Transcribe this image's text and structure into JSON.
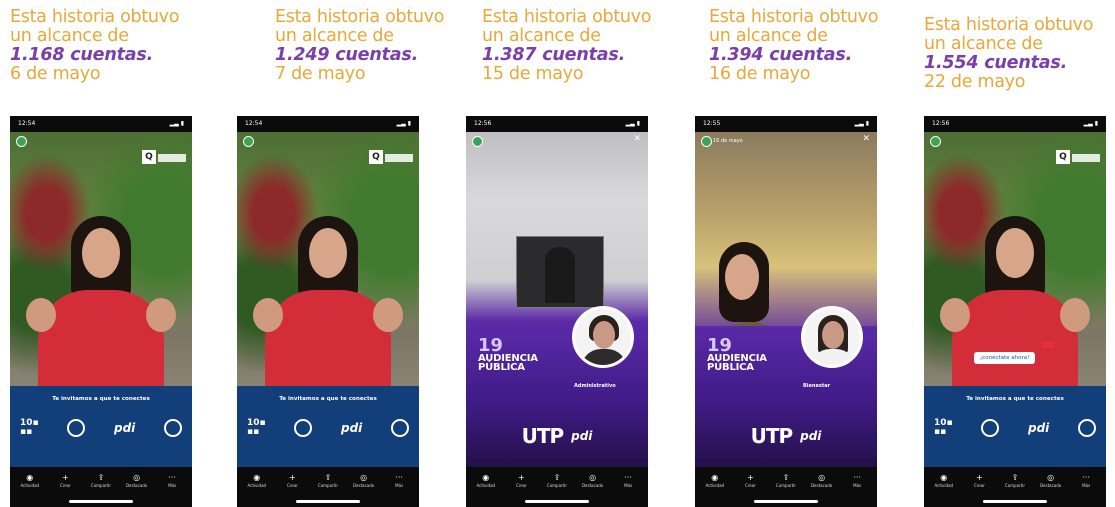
{
  "stories": [
    {
      "caption_line1": "Esta historia obtuvo",
      "caption_line2": "un alcance de",
      "reach": "1.168 cuentas.",
      "date": "6 de mayo",
      "status_time": "12:54",
      "banner_title": "Te invitamos a que te conectes"
    },
    {
      "caption_line1": "Esta historia obtuvo",
      "caption_line2": "un alcance de",
      "reach": "1.249 cuentas.",
      "date": "7 de mayo",
      "status_time": "12:54",
      "banner_title": "Te invitamos a que te conectes"
    },
    {
      "caption_line1": "Esta historia obtuvo",
      "caption_line2": "un alcance de",
      "reach": "1.387 cuentas.",
      "date": "15 de mayo",
      "status_time": "12:56",
      "event_number": "19",
      "event_title_1": "AUDIENCIA",
      "event_title_2": "PÚBLICA",
      "speaker_role": "Administrativo",
      "utp_logo": "UTP",
      "pdi_logo": "pdi"
    },
    {
      "caption_line1": "Esta historia obtuvo",
      "caption_line2": "un alcance de",
      "reach": "1.394 cuentas.",
      "date": "16 de mayo",
      "status_time": "12:55",
      "story_user": "16 de mayo",
      "event_number": "19",
      "event_title_1": "AUDIENCIA",
      "event_title_2": "PÚBLICA",
      "speaker_role": "Bienestar",
      "utp_logo": "UTP",
      "pdi_logo": "pdi"
    },
    {
      "caption_line1": "Esta historia obtuvo",
      "caption_line2": "un alcance de",
      "reach": "1.554 cuentas.",
      "date": "22 de mayo",
      "status_time": "12:56",
      "cta_label": "¡conéctate ahora!",
      "banner_title": "Te invitamos a que te conectes"
    }
  ],
  "nav": {
    "items": [
      {
        "label": "Actividad",
        "icon": "eye-icon",
        "glyph": "◉"
      },
      {
        "label": "Crear",
        "icon": "plus-icon",
        "glyph": "+"
      },
      {
        "label": "Compartir",
        "icon": "share-icon",
        "glyph": "⇪"
      },
      {
        "label": "Destacado",
        "icon": "highlight-icon",
        "glyph": "◎"
      },
      {
        "label": "Más",
        "icon": "more-icon",
        "glyph": "···"
      }
    ]
  },
  "colors": {
    "caption": "#e8a83a",
    "reach": "#7a3fa8",
    "banner": "#123e7a",
    "event_purple": "#5a2aa8"
  }
}
